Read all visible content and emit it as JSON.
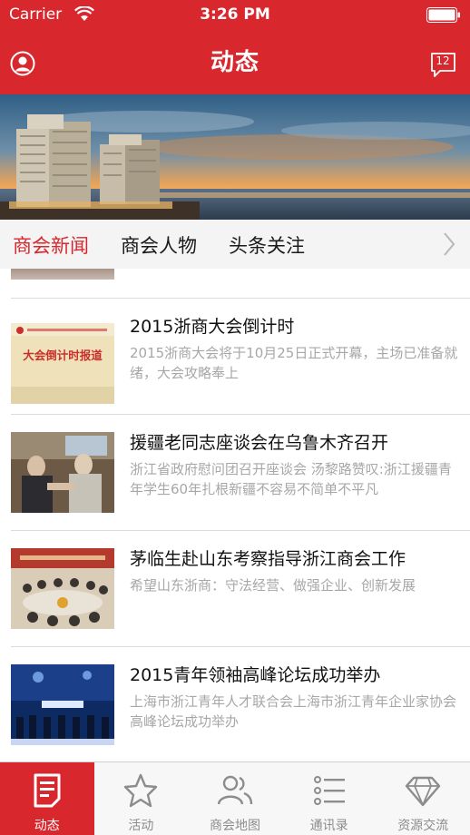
{
  "status_bar": {
    "carrier": "Carrier",
    "time": "3:26 PM"
  },
  "nav": {
    "title": "动态",
    "message_count": "12"
  },
  "tabs": [
    {
      "label": "商会新闻",
      "active": true
    },
    {
      "label": "商会人物",
      "active": false
    },
    {
      "label": "头条关注",
      "active": false
    }
  ],
  "news": [
    {
      "title": "2015浙商大会倒计时",
      "summary": "2015浙商大会将于10月25日正式开幕，主场已准备就绪，大会攻略奉上",
      "thumb_caption": "大会倒计时报道"
    },
    {
      "title": "援疆老同志座谈会在乌鲁木齐召开",
      "summary": "浙江省政府慰问团召开座谈会 汤黎路赞叹:浙江援疆青年学生60年扎根新疆不容易不简单不平凡"
    },
    {
      "title": "茅临生赴山东考察指导浙江商会工作",
      "summary": "希望山东浙商：守法经营、做强企业、创新发展"
    },
    {
      "title": "2015青年领袖高峰论坛成功举办",
      "summary": "上海市浙江青年人才联合会上海市浙江青年企业家协会高峰论坛成功举办"
    }
  ],
  "tabbar": [
    {
      "label": "动态",
      "icon": "news-doc-icon",
      "active": true
    },
    {
      "label": "活动",
      "icon": "star-icon",
      "active": false
    },
    {
      "label": "商会地图",
      "icon": "people-icon",
      "active": false
    },
    {
      "label": "通讯录",
      "icon": "list-icon",
      "active": false
    },
    {
      "label": "资源交流",
      "icon": "diamond-icon",
      "active": false
    }
  ],
  "colors": {
    "brand_red": "#d8272d",
    "summary_gray": "#a7a7a7",
    "tabbar_inactive": "#8c8c8c"
  }
}
